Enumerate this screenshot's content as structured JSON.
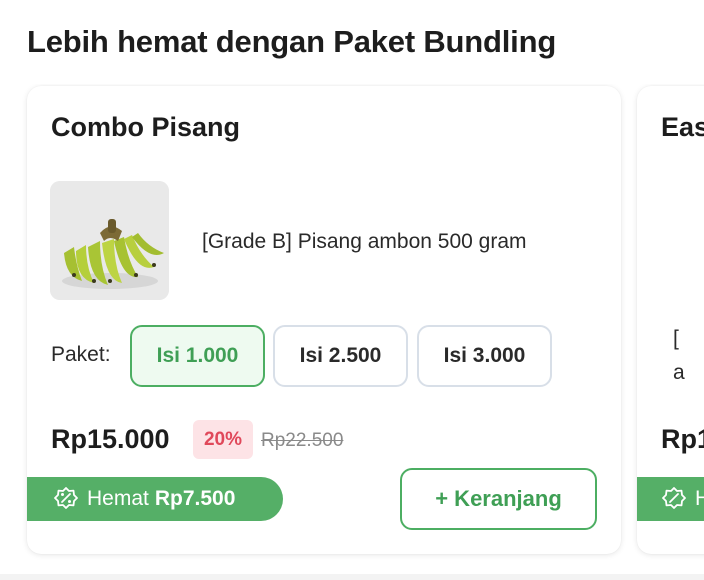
{
  "section": {
    "title": "Lebih hemat dengan Paket Bundling"
  },
  "cards": [
    {
      "title": "Combo Pisang",
      "product_name": "[Grade B] Pisang ambon 500 gram",
      "package_label": "Paket:",
      "packages": [
        {
          "label": "Isi 1.000",
          "selected": true
        },
        {
          "label": "Isi 2.500",
          "selected": false
        },
        {
          "label": "Isi 3.000",
          "selected": false
        }
      ],
      "price": "Rp15.000",
      "discount": "20%",
      "old_price": "Rp22.500",
      "savings_label": "Hemat",
      "savings_amount": "Rp7.500",
      "cart_button": "+ Keranjang"
    },
    {
      "title": "Eas",
      "product_name_line1": "[",
      "product_name_line2": "a",
      "price": "Rp1",
      "savings_label": "H"
    }
  ],
  "colors": {
    "accent_green": "#4cae62",
    "badge_green": "#55af67",
    "discount_red": "#e0485a",
    "discount_bg": "#fde3e6"
  },
  "icons": {
    "savings": "percent-badge-icon",
    "product": "banana-photo"
  }
}
